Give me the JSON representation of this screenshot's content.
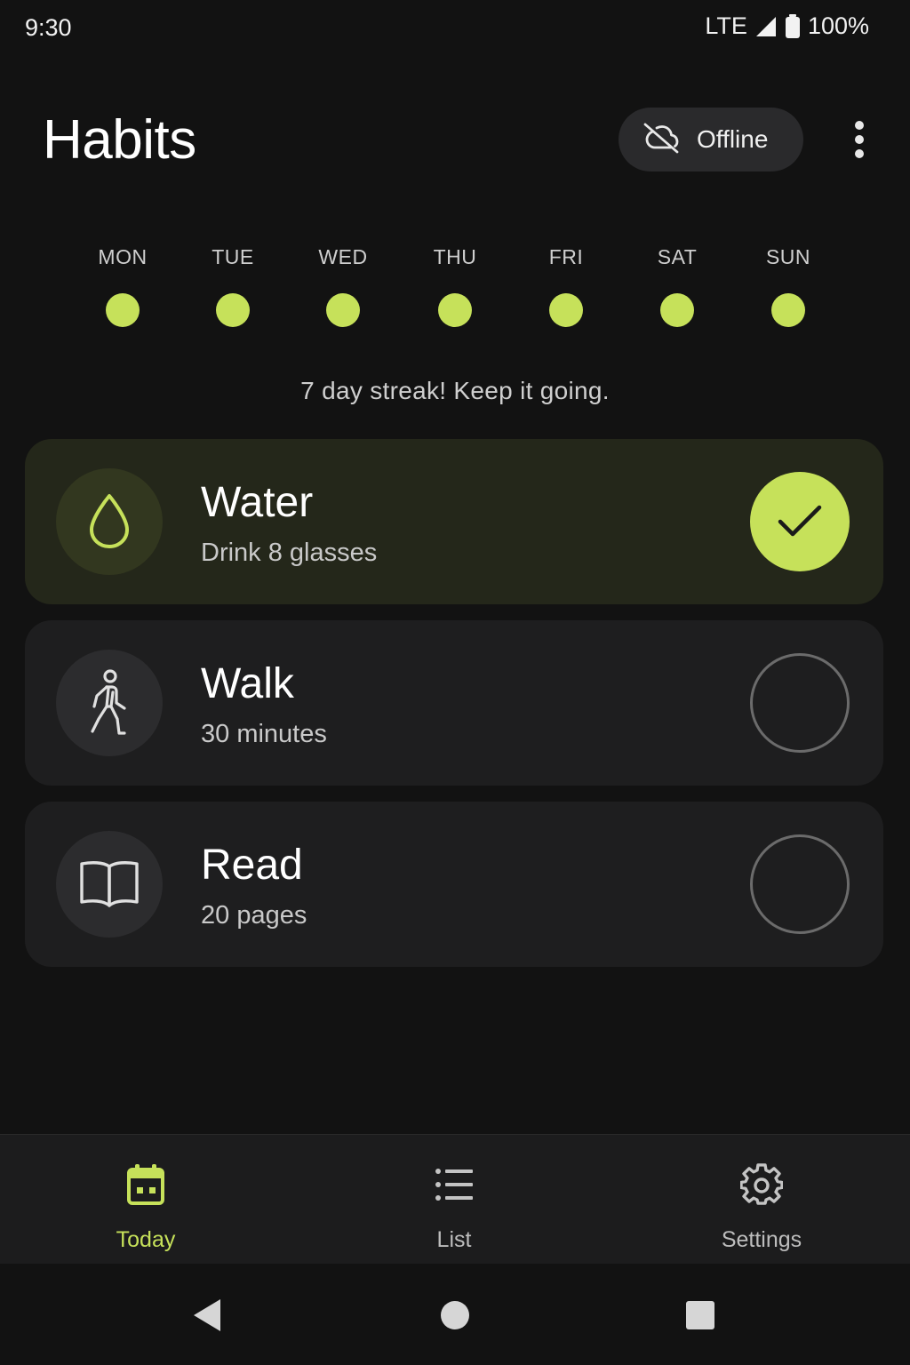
{
  "status_bar": {
    "time": "9:30",
    "network": "LTE",
    "battery": "100%"
  },
  "header": {
    "title": "Habits",
    "offline_label": "Offline"
  },
  "week": {
    "days": [
      {
        "label": "MON",
        "done": true
      },
      {
        "label": "TUE",
        "done": true
      },
      {
        "label": "WED",
        "done": true
      },
      {
        "label": "THU",
        "done": true
      },
      {
        "label": "FRI",
        "done": true
      },
      {
        "label": "SAT",
        "done": true
      },
      {
        "label": "SUN",
        "done": true
      }
    ],
    "streak_text": "7 day streak! Keep it going."
  },
  "habits": [
    {
      "name": "Water",
      "detail": "Drink 8 glasses",
      "icon": "water-drop-icon",
      "done": true
    },
    {
      "name": "Walk",
      "detail": "30 minutes",
      "icon": "walking-icon",
      "done": false
    },
    {
      "name": "Read",
      "detail": "20 pages",
      "icon": "book-icon",
      "done": false
    }
  ],
  "bottom_nav": {
    "items": [
      {
        "label": "Today",
        "icon": "calendar-icon",
        "active": true
      },
      {
        "label": "List",
        "icon": "list-icon",
        "active": false
      },
      {
        "label": "Settings",
        "icon": "gear-icon",
        "active": false
      }
    ]
  },
  "colors": {
    "accent": "#c6e15a",
    "background": "#121212",
    "card": "#1e1e1f",
    "card_done": "#24271a"
  }
}
